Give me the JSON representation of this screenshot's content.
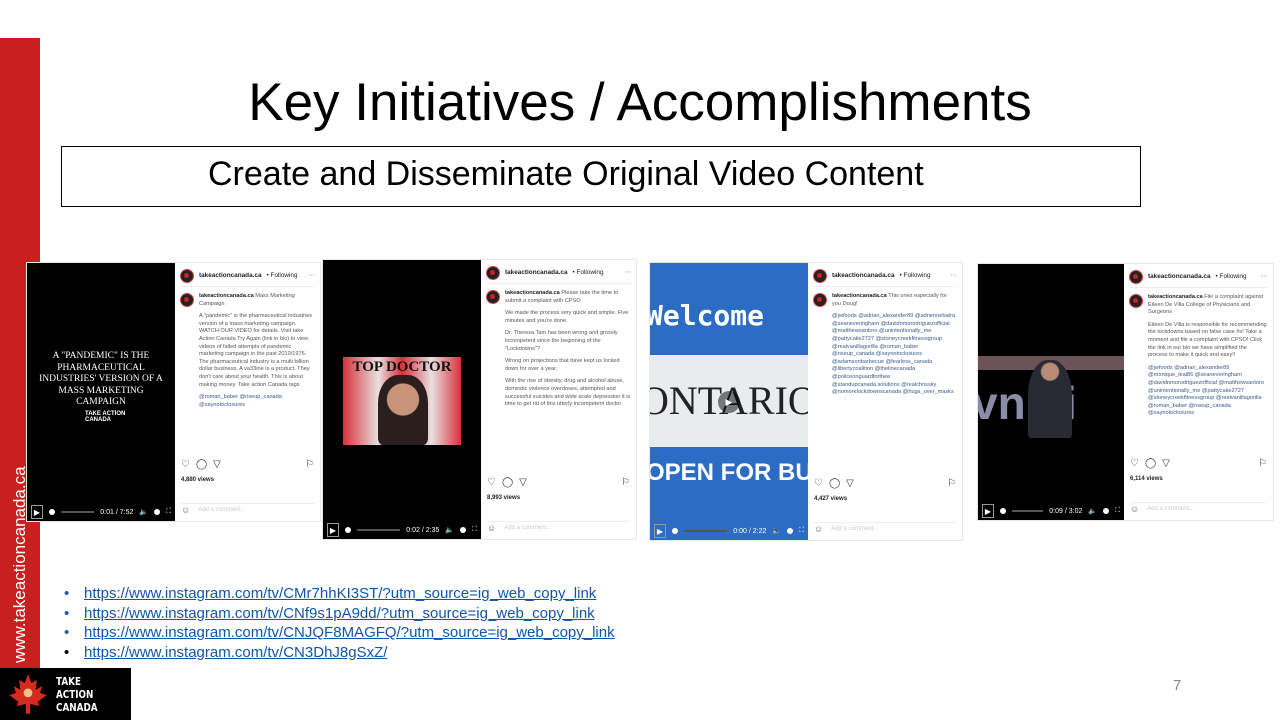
{
  "sidebar": {
    "website": "www.takeactioncanada.ca",
    "logo_text": [
      "TAKE",
      "ACTION",
      "CANADA"
    ],
    "accent": "#c8201f"
  },
  "title": "Key Initiatives / Accomplishments",
  "subtitle": "Create and Disseminate Original Video Content",
  "posts": [
    {
      "account": "takeactioncanada.ca",
      "follow": "• Following",
      "caption_title": "Mass Marketing Campaign",
      "paragraphs": [
        "A \"pandemic\" is the pharmaceutical industries version of a mass marketing campaign. WATCH OUR VIDEO for details. Visit take Action Canada Try Again (link in bio) to view videos of failed attempts of pandemic marketing campaign in the past 2010/1976. The pharmaceutical industry is a multi billion dollar business. A va33ine is a product. They don't care about your health. This is about making money. Take action Canada tags"
      ],
      "tags": "@roman_baber @riseup_canada @saynotoclosures",
      "views": "4,880 views",
      "time": "0:01 / 7:52",
      "video_text": "A \"PANDEMIC\" IS THE PHARMACEUTICAL INDUSTRIES' VERSION OF A MASS MARKETING CAMPAIGN",
      "video_logo": "TAKE ACTION CANADA",
      "comment_placeholder": "Add a comment..."
    },
    {
      "account": "takeactioncanada.ca",
      "follow": "• Following",
      "caption_title": "Please take the time to submit a complaint with CPSO",
      "paragraphs": [
        "We made the process very quick and simple. Five minutes and you're done.",
        "Dr. Theresa Tam has been wrong and grossly incompetent since the beginning of the \"Lockdowns\"?",
        "Wrong on projections that have kept us locked down for over a year.",
        "With the rise of obesity, drug and alcohol abuse, domestic violence overdoses, attempted and successful suicides and wide scale depression it is time to get rid of this utterly incompetent doctor"
      ],
      "tags": "",
      "views": "8,993 views",
      "time": "0:02 / 2:35",
      "video_text": "TOP DOCTOR",
      "comment_placeholder": "Add a comment..."
    },
    {
      "account": "takeactioncanada.ca",
      "follow": "• Following",
      "caption_title": "This ones especially for you Doug!",
      "paragraphs": [],
      "tags": "@jwfoods @adrian_alexander89 @adriennebatra @seaneveringham @davidnmorodriguezofficial @matthewsantoro @unintentionally_me @pattycake2727 @stoneycreekfitnessgroup @realvanillagorilla @roman_baber @riseup_canada @saynotoclosures @adamsonbarbecue @fearless_canada @libertycoalition @thelinecanada @policeonguardforthee @standupcanada.solutions @realchrissky @nomorelockdownscanada @hugs_over_masks",
      "views": "4,427 views",
      "time": "0:00 / 2:22",
      "video_text": "Welcome",
      "video_text2": "ONTARIO",
      "video_text3": "OPEN FOR BUSINESS",
      "comment_placeholder": "Add a comment..."
    },
    {
      "account": "takeactioncanada.ca",
      "follow": "• Following",
      "caption_title": "File a complaint against Eileen De Villa College of Physicians and Surgeons",
      "paragraphs": [
        "Eileen De Villa is responsible for recommending the lockdowns based on false case #s! Take a moment and file a complaint with CPSO! Click the link in our bio we have simplified the process to make it quick and easy!!"
      ],
      "tags": "@jwfoods @adrian_alexander89 @monique_leal86 @seaneveringham @davidnmorodriguezofficial @matthewsantoro @unintentionally_me @pattycake2727 @stoneycreekfitnessgroup @realvanillagorilla @roman_baber @riseup_canada @saynotoclosures",
      "views": "6,114 views",
      "time": "0:09 / 3:02",
      "video_text": "vn vi",
      "comment_placeholder": "Add a comment..."
    }
  ],
  "links": [
    "https://www.instagram.com/tv/CMr7hhKI3ST/?utm_source=ig_web_copy_link",
    "https://www.instagram.com/tv/CNf9s1pA9dd/?utm_source=ig_web_copy_link",
    "https://www.instagram.com/tv/CNJQF8MAGFQ/?utm_source=ig_web_copy_link",
    "https://www.instagram.com/tv/CN3DhJ8gSxZ/"
  ],
  "page_number": "7"
}
